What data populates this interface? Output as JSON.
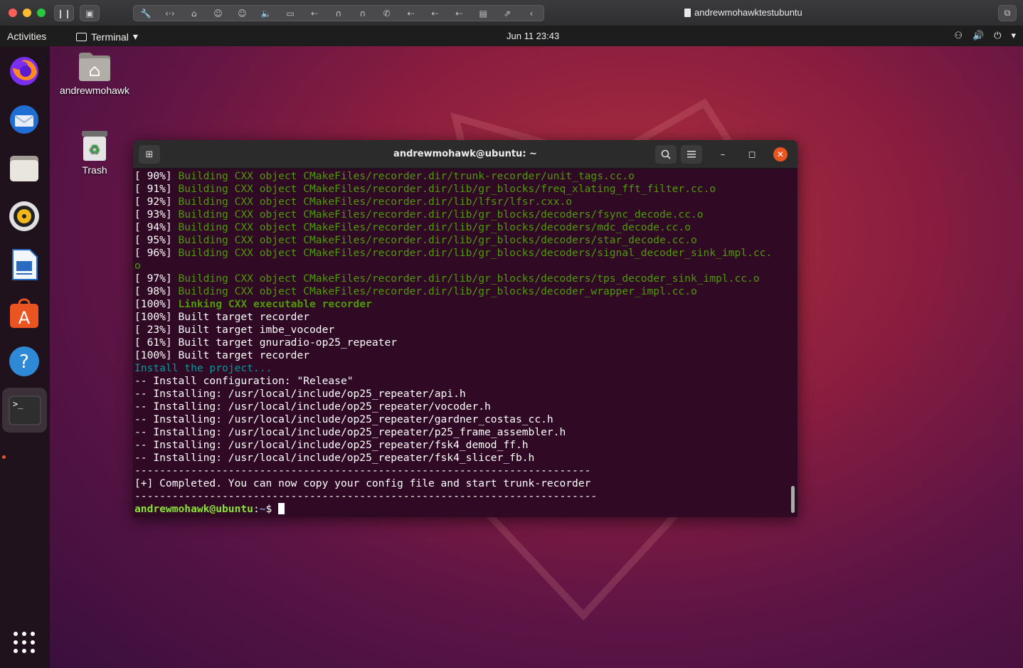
{
  "host": {
    "title": "andrewmohawktestubuntu"
  },
  "panel": {
    "activities": "Activities",
    "app_menu": "Terminal",
    "clock": "Jun 11  23:43"
  },
  "desktop_icons": {
    "home": "andrewmohawk",
    "trash": "Trash"
  },
  "dock": {
    "items": [
      "Firefox",
      "Thunderbird",
      "Files",
      "Rhythmbox",
      "LibreOffice Writer",
      "Ubuntu Software",
      "Help",
      "Terminal"
    ]
  },
  "terminal": {
    "title": "andrewmohawk@ubuntu: ~",
    "lines": [
      {
        "prefix": "[ 90%] ",
        "text": "Building CXX object CMakeFiles/recorder.dir/trunk-recorder/unit_tags.cc.o",
        "style": "g"
      },
      {
        "prefix": "[ 91%] ",
        "text": "Building CXX object CMakeFiles/recorder.dir/lib/gr_blocks/freq_xlating_fft_filter.cc.o",
        "style": "g"
      },
      {
        "prefix": "[ 92%] ",
        "text": "Building CXX object CMakeFiles/recorder.dir/lib/lfsr/lfsr.cxx.o",
        "style": "g"
      },
      {
        "prefix": "[ 93%] ",
        "text": "Building CXX object CMakeFiles/recorder.dir/lib/gr_blocks/decoders/fsync_decode.cc.o",
        "style": "g"
      },
      {
        "prefix": "[ 94%] ",
        "text": "Building CXX object CMakeFiles/recorder.dir/lib/gr_blocks/decoders/mdc_decode.cc.o",
        "style": "g"
      },
      {
        "prefix": "[ 95%] ",
        "text": "Building CXX object CMakeFiles/recorder.dir/lib/gr_blocks/decoders/star_decode.cc.o",
        "style": "g"
      },
      {
        "prefix": "[ 96%] ",
        "text": "Building CXX object CMakeFiles/recorder.dir/lib/gr_blocks/decoders/signal_decoder_sink_impl.cc.",
        "style": "g"
      },
      {
        "prefix": "",
        "text": "o",
        "style": "g"
      },
      {
        "prefix": "[ 97%] ",
        "text": "Building CXX object CMakeFiles/recorder.dir/lib/gr_blocks/decoders/tps_decoder_sink_impl.cc.o",
        "style": "g"
      },
      {
        "prefix": "[ 98%] ",
        "text": "Building CXX object CMakeFiles/recorder.dir/lib/gr_blocks/decoder_wrapper_impl.cc.o",
        "style": "g"
      },
      {
        "prefix": "[100%] ",
        "text": "Linking CXX executable recorder",
        "style": "gb"
      },
      {
        "prefix": "[100%] ",
        "text": "Built target recorder",
        "style": ""
      },
      {
        "prefix": "[ 23%] ",
        "text": "Built target imbe_vocoder",
        "style": ""
      },
      {
        "prefix": "[ 61%] ",
        "text": "Built target gnuradio-op25_repeater",
        "style": ""
      },
      {
        "prefix": "[100%] ",
        "text": "Built target recorder",
        "style": ""
      },
      {
        "prefix": "",
        "text": "Install the project...",
        "style": "c"
      },
      {
        "prefix": "",
        "text": "-- Install configuration: \"Release\"",
        "style": ""
      },
      {
        "prefix": "",
        "text": "-- Installing: /usr/local/include/op25_repeater/api.h",
        "style": ""
      },
      {
        "prefix": "",
        "text": "-- Installing: /usr/local/include/op25_repeater/vocoder.h",
        "style": ""
      },
      {
        "prefix": "",
        "text": "-- Installing: /usr/local/include/op25_repeater/gardner_costas_cc.h",
        "style": ""
      },
      {
        "prefix": "",
        "text": "-- Installing: /usr/local/include/op25_repeater/p25_frame_assembler.h",
        "style": ""
      },
      {
        "prefix": "",
        "text": "-- Installing: /usr/local/include/op25_repeater/fsk4_demod_ff.h",
        "style": ""
      },
      {
        "prefix": "",
        "text": "-- Installing: /usr/local/include/op25_repeater/fsk4_slicer_fb.h",
        "style": ""
      },
      {
        "prefix": "",
        "text": "-------------------------------------------------------------------------",
        "style": ""
      },
      {
        "prefix": "",
        "text": "[+] Completed. You can now copy your config file and start trunk-recorder",
        "style": ""
      },
      {
        "prefix": "",
        "text": "--------------------------------------------------------------------------",
        "style": ""
      }
    ],
    "prompt_user": "andrewmohawk@ubuntu",
    "prompt_sep": ":",
    "prompt_path": "~",
    "prompt_symbol": "$ "
  },
  "colors": {
    "terminal_bg": "#300a24",
    "green": "#4e9a06",
    "cyan": "#06989a",
    "ubuntu_orange": "#e95420"
  }
}
